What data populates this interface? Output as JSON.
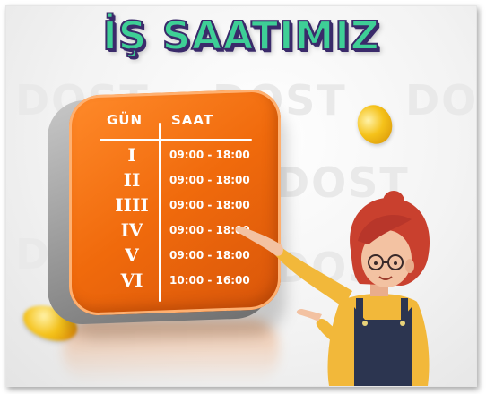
{
  "title": "İŞ SAATIMIZ",
  "watermark_text": "DOST",
  "schedule": {
    "col_day": "GÜN",
    "col_time": "SAAT",
    "rows": [
      {
        "day": "I",
        "hours": "09:00 - 18:00"
      },
      {
        "day": "II",
        "hours": "09:00 - 18:00"
      },
      {
        "day": "IIII",
        "hours": "09:00 - 18:00"
      },
      {
        "day": "IV",
        "hours": "09:00 - 18:00"
      },
      {
        "day": "V",
        "hours": "09:00 - 18:00"
      },
      {
        "day": "VI",
        "hours": "10:00 - 16:00"
      }
    ]
  },
  "colors": {
    "board_orange": "#f06a0c",
    "title_green": "#3ecf96",
    "title_outline": "#3a2a6a",
    "sweater_yellow": "#f2b83a",
    "hair_red": "#c9402e",
    "overalls_navy": "#2c3550"
  },
  "icons": [
    "gold-coin-icon"
  ]
}
